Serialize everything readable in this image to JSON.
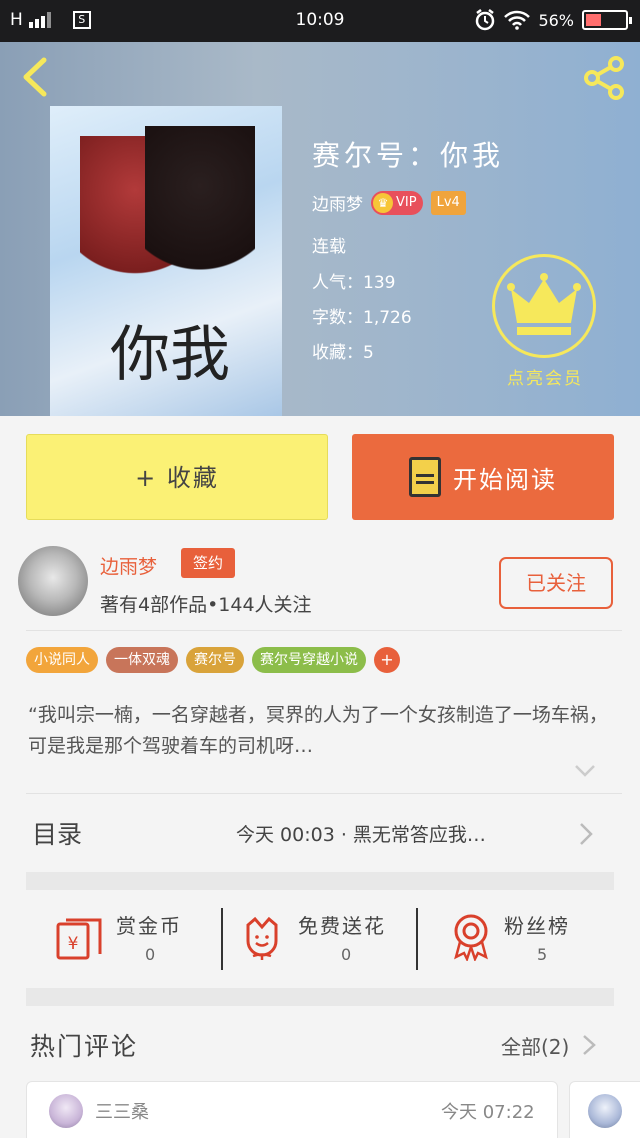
{
  "status_bar": {
    "network": "H",
    "sim_icon": "S",
    "time": "10:09",
    "battery_percent": "56%",
    "battery_level": 0.4
  },
  "header": {
    "book_title": "赛尔号：你我",
    "cover_title": "你我",
    "author": "边雨梦",
    "vip_label": "VIP",
    "level": "Lv4",
    "status": "连载",
    "popularity_label": "人气：",
    "popularity": "139",
    "word_count_label": "字数：",
    "word_count": "1,726",
    "favorites_label": "收藏：",
    "favorites": "5",
    "member_label": "点亮会员"
  },
  "actions": {
    "favorite_label": "+ 收藏",
    "read_label": "开始阅读"
  },
  "author_section": {
    "name": "边雨梦",
    "sign_badge": "签约",
    "stats": "著有4部作品•144人关注",
    "follow_label": "已关注"
  },
  "tags": [
    {
      "label": "小说同人",
      "color": "#f2a53b"
    },
    {
      "label": "一体双魂",
      "color": "#c8755a"
    },
    {
      "label": "赛尔号",
      "color": "#d9a33a"
    },
    {
      "label": "赛尔号穿越小说",
      "color": "#8cbd4a"
    }
  ],
  "tag_more": "+",
  "synopsis": "“我叫宗一楠，一名穿越者，冥界的人为了一个女孩制造了一场车祸，可是我是那个驾驶着车的司机呀…",
  "catalog": {
    "title": "目录",
    "latest": "今天 00:03 · 黑无常答应我…"
  },
  "rewards": [
    {
      "label": "赏金币",
      "value": "0"
    },
    {
      "label": "免费送花",
      "value": "0"
    },
    {
      "label": "粉丝榜",
      "value": "5"
    }
  ],
  "comments": {
    "title": "热门评论",
    "all_label": "全部(2)",
    "items": [
      {
        "user": "三三桑",
        "time": "今天 07:22"
      }
    ]
  },
  "colors": {
    "accent": "#eb6a3e",
    "favorite_button": "#fbf175",
    "member_gold": "#f6e85b"
  }
}
